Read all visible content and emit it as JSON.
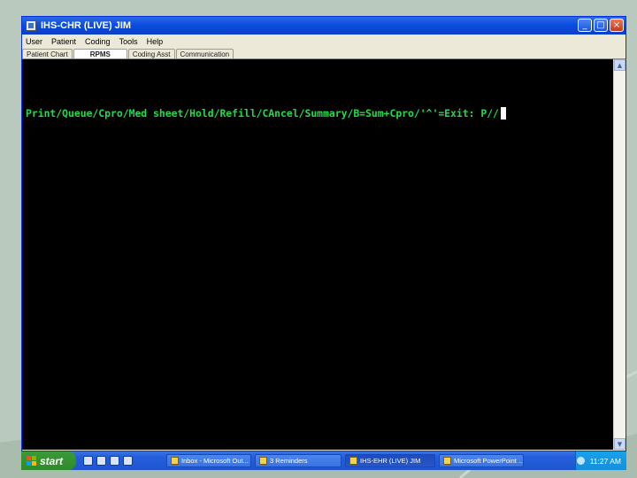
{
  "window": {
    "title": "IHS-CHR (LIVE) JIM",
    "controls": {
      "minimize": "_",
      "maximize": "□",
      "close": "×"
    }
  },
  "menu": [
    "User",
    "Patient",
    "Coding",
    "Tools",
    "Help"
  ],
  "tabs": [
    {
      "label": "Patient Chart",
      "active": false
    },
    {
      "label": "RPMS",
      "active": true
    },
    {
      "label": "Coding Asst",
      "active": false
    },
    {
      "label": "Communication",
      "active": false
    }
  ],
  "terminal": {
    "prompt_line": "Print/Queue/Cpro/Med sheet/Hold/Refill/CAncel/Summary/B=Sum+Cpro/'^'=Exit: P//"
  },
  "taskbar": {
    "start_label": "start",
    "items": [
      {
        "label": "Inbox - Microsoft Out...",
        "active": false
      },
      {
        "label": "3 Reminders",
        "active": false
      },
      {
        "label": "IHS-EHR (LIVE) JIM",
        "active": true
      },
      {
        "label": "Microsoft PowerPoint ...",
        "active": false
      }
    ],
    "clock": "11:27 AM"
  },
  "colors": {
    "terminal_text": "#27d84a",
    "titlebar": "#0b4de0",
    "start_button": "#2f8a2b"
  }
}
